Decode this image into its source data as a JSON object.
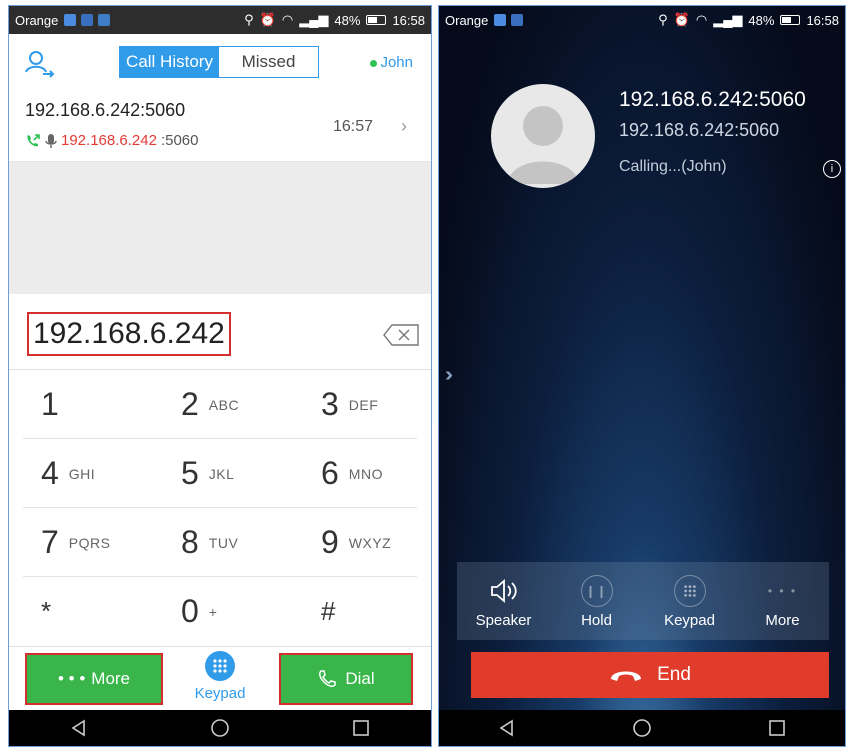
{
  "left": {
    "status": {
      "carrier": "Orange",
      "battery": "48%",
      "time": "16:58"
    },
    "tabs": [
      {
        "label": "Call History",
        "active": true
      },
      {
        "label": "Missed",
        "active": false
      }
    ],
    "account": "John",
    "history": {
      "name": "192.168.6.242:5060",
      "sub_red": "192.168.6.242",
      "sub_rest": ":5060",
      "time": "16:57"
    },
    "dial_number": "192.168.6.242",
    "keys": [
      {
        "digit": "1",
        "letters": ""
      },
      {
        "digit": "2",
        "letters": "ABC"
      },
      {
        "digit": "3",
        "letters": "DEF"
      },
      {
        "digit": "4",
        "letters": "GHI"
      },
      {
        "digit": "5",
        "letters": "JKL"
      },
      {
        "digit": "6",
        "letters": "MNO"
      },
      {
        "digit": "7",
        "letters": "PQRS"
      },
      {
        "digit": "8",
        "letters": "TUV"
      },
      {
        "digit": "9",
        "letters": "WXYZ"
      },
      {
        "digit": "*",
        "letters": ""
      },
      {
        "digit": "0",
        "letters": "+"
      },
      {
        "digit": "#",
        "letters": ""
      }
    ],
    "buttons": {
      "more": "More",
      "keypad": "Keypad",
      "dial": "Dial"
    }
  },
  "right": {
    "status": {
      "carrier": "Orange",
      "battery": "48%",
      "time": "16:58"
    },
    "caller_name": "192.168.6.242:5060",
    "caller_address": "192.168.6.242:5060",
    "call_status": "Calling...(John)",
    "controls": [
      {
        "label": "Speaker",
        "icon": "speaker-icon"
      },
      {
        "label": "Hold",
        "icon": "pause-icon"
      },
      {
        "label": "Keypad",
        "icon": "keypad-icon"
      },
      {
        "label": "More",
        "icon": "more-icon"
      }
    ],
    "end_label": "End"
  },
  "colors": {
    "accent": "#2f9be9",
    "green": "#3ab54a",
    "red_outline": "#d32f2f",
    "end": "#e03b2b"
  }
}
